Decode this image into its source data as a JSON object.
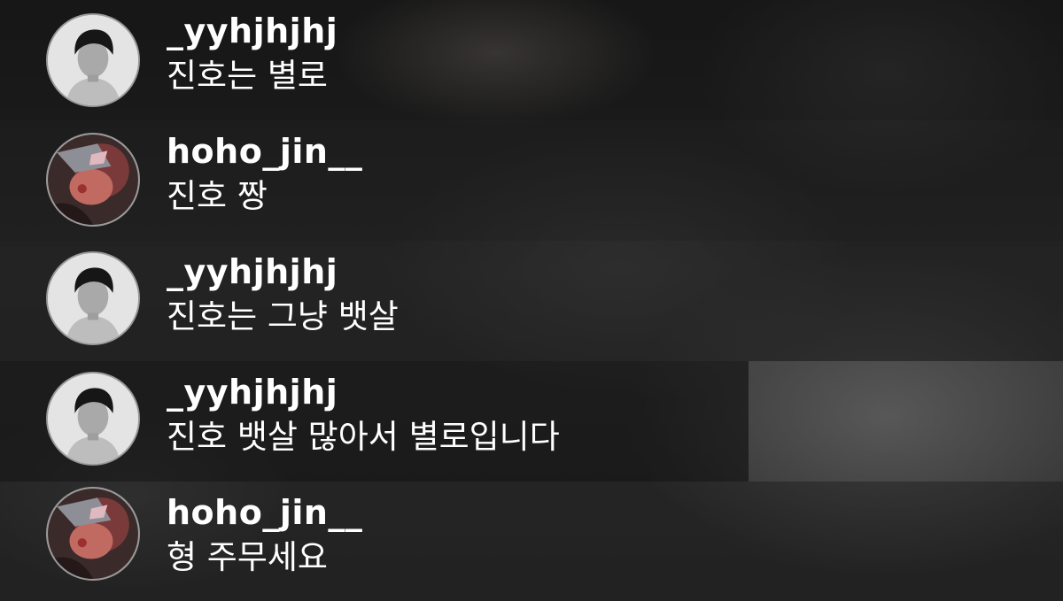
{
  "comments": [
    {
      "username": "_yyhjhjhj",
      "message": "진호는 별로",
      "avatar": "bw-profile-avatar"
    },
    {
      "username": "hoho_jin__",
      "message": "진호 짱",
      "avatar": "red-profile-avatar"
    },
    {
      "username": "_yyhjhjhj",
      "message": "진호는 그냥 뱃살",
      "avatar": "bw-profile-avatar"
    },
    {
      "username": "_yyhjhjhj",
      "message": "진호 뱃살 많아서 별로입니다",
      "avatar": "bw-profile-avatar"
    },
    {
      "username": "hoho_jin__",
      "message": "형 주무세요",
      "avatar": "red-profile-avatar"
    }
  ],
  "colors": {
    "text": "#ffffff",
    "avatar_border": "#9a9a9a",
    "row_overlay": "#080808"
  }
}
